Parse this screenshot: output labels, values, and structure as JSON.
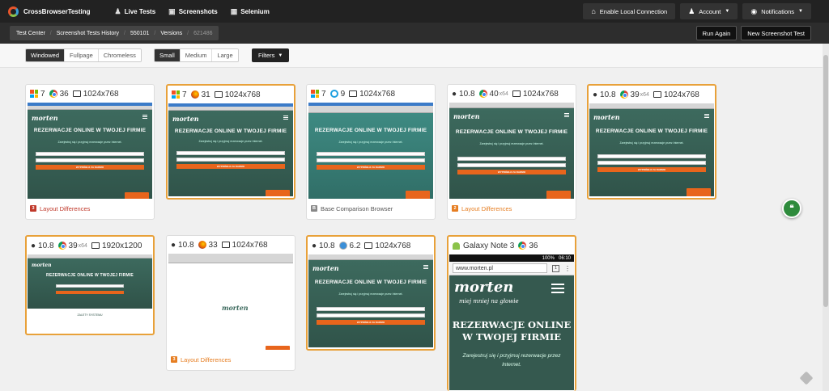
{
  "topnav": {
    "brand": "CrossBrowserTesting",
    "links": [
      {
        "label": "Live Tests",
        "icon": "user-icon"
      },
      {
        "label": "Screenshots",
        "icon": "camera-icon"
      },
      {
        "label": "Selenium",
        "icon": "selenium-icon"
      }
    ],
    "local_connection": "Enable Local Connection",
    "account": "Account",
    "notifications": "Notifications"
  },
  "subnav": {
    "breadcrumb": [
      "Test Center",
      "Screenshot Tests History",
      "550101",
      "Versions",
      "621486"
    ],
    "run_again": "Run Again",
    "new_test": "New Screenshot Test"
  },
  "toolbar": {
    "layout_modes": [
      "Windowed",
      "Fullpage",
      "Chromeless"
    ],
    "layout_selected": "Windowed",
    "sizes": [
      "Small",
      "Medium",
      "Large"
    ],
    "size_selected": "Small",
    "filters": "Filters"
  },
  "cards": [
    {
      "os": "7",
      "browser": "36",
      "res": "1024x768",
      "footer": "Layout Differences",
      "count": "3"
    },
    {
      "os": "7",
      "browser": "31",
      "res": "1024x768"
    },
    {
      "os": "7",
      "browser": "9",
      "res": "1024x768",
      "footer": "Base Comparison Browser",
      "count": "B"
    },
    {
      "os": "10.8",
      "browser": "40",
      "browser_sub": "x64",
      "res": "1024x768",
      "footer": "Layout Differences",
      "count": "2"
    },
    {
      "os": "10.8",
      "browser": "39",
      "browser_sub": "x64",
      "res": "1024x768"
    },
    {
      "os": "10.8",
      "browser": "39",
      "browser_sub": "x64",
      "res": "1920x1200"
    },
    {
      "os": "10.8",
      "browser": "33",
      "res": "1024x768",
      "footer": "Layout Differences",
      "count": "3"
    },
    {
      "os": "10.8",
      "browser": "6.2",
      "res": "1024x768"
    },
    {
      "os": "Galaxy Note 3",
      "browser": "36"
    }
  ],
  "site": {
    "logo": "morten",
    "headline": "REZERWACJE ONLINE W TWOJEJ FIRMIE",
    "tagline": "Zarejestruj się i przyjmuj rezerwacje przez Internet.",
    "cta": "WYPRÓBUJ ZA DARMO",
    "url": "www.morten.pl",
    "slogan": "miej mniej na głowie",
    "status_time": "06:10",
    "battery": "100%",
    "footer_heading": "ZALETY SYSTEMU"
  },
  "colors": {
    "accent": "#e8a13a",
    "danger": "#c0392b",
    "warning": "#e67e22",
    "chat": "#2e8b3c"
  },
  "chat_icon": "quote-icon"
}
